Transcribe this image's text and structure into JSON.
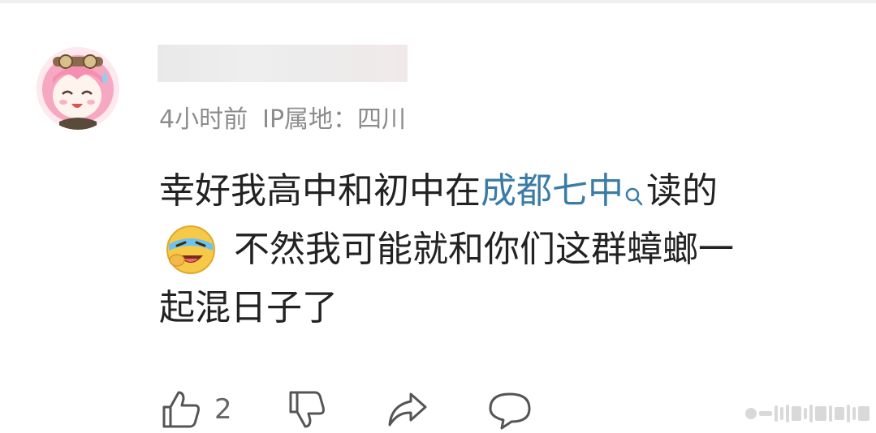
{
  "comment": {
    "author": {
      "avatar_icon": "anime-girl-avatar",
      "username_hidden": true
    },
    "meta": {
      "time": "4小时前",
      "ip_location": "IP属地：四川"
    },
    "body": {
      "line1_prefix": "幸好我高中和初中在",
      "link_text": "成都七中",
      "link_icon": "search-icon",
      "line1_suffix": "读的",
      "emoji": "laughing-crying-emoji",
      "line2": "不然我可能就和你们这群蟑螂一",
      "line3": "起混日子了"
    },
    "actions": {
      "like_count": "2",
      "like_icon": "thumbs-up-icon",
      "dislike_icon": "thumbs-down-icon",
      "share_icon": "share-icon",
      "reply_icon": "comment-icon"
    }
  },
  "colors": {
    "link": "#3a7ca5",
    "text": "#222222",
    "meta": "#8c8c8c",
    "icon": "#555555"
  }
}
